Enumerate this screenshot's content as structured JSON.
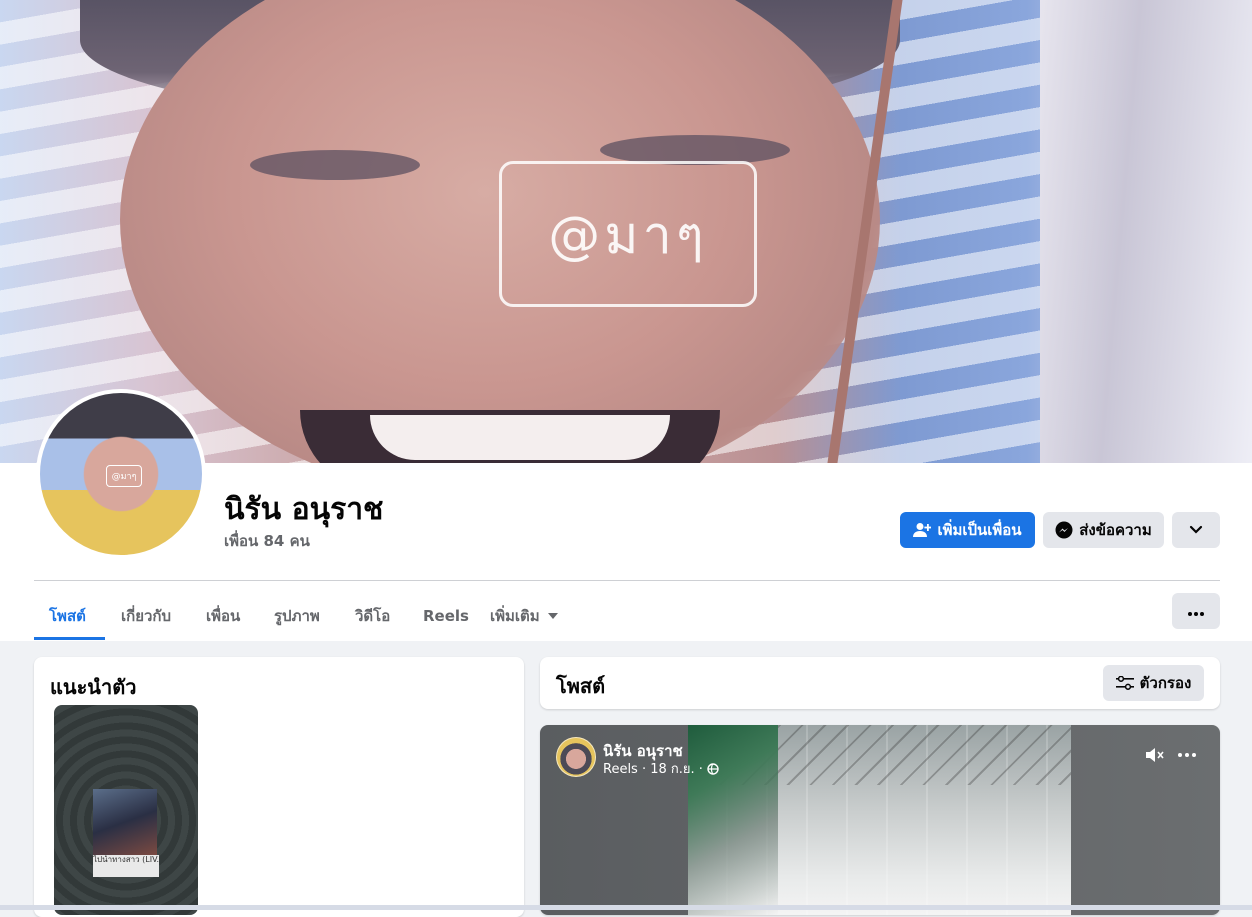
{
  "cover": {
    "watermark_text": "@มาๆ"
  },
  "profile": {
    "name": "นิรัน อนุราช",
    "friends_text": "เพื่อน 84 คน",
    "avatar_watermark": "@มาๆ"
  },
  "actions": {
    "add_friend": "เพิ่มเป็นเพื่อน",
    "message": "ส่งข้อความ"
  },
  "tabs": [
    {
      "label": "โพสต์",
      "active": true
    },
    {
      "label": "เกี่ยวกับ"
    },
    {
      "label": "เพื่อน"
    },
    {
      "label": "รูปภาพ"
    },
    {
      "label": "วิดีโอ"
    },
    {
      "label": "Reels"
    },
    {
      "label": "เพิ่มเติม"
    }
  ],
  "intro": {
    "title": "แนะนำตัว",
    "featured_caption": "ไปนำทางสาว (LIV..."
  },
  "posts": {
    "title": "โพสต์",
    "filter_label": "ตัวกรอง"
  },
  "reel": {
    "author": "นิรัน อนุราช",
    "meta": "Reels · 18 ก.ย. ·"
  },
  "colors": {
    "accent": "#1b74e4",
    "secondary_button": "#e4e6eb",
    "page_bg": "#f0f2f5"
  }
}
